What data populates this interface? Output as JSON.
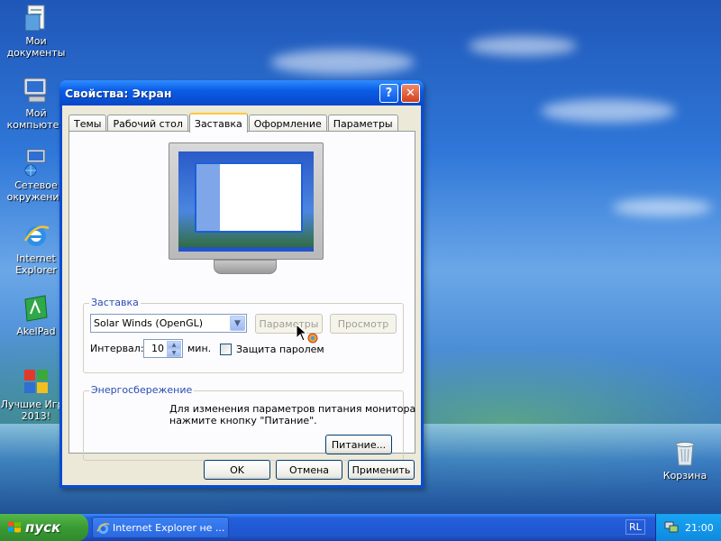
{
  "desktop": {
    "icons": [
      {
        "label": "Мои документы",
        "icon": "folder-icon"
      },
      {
        "label": "Мой компьютер",
        "icon": "computer-icon"
      },
      {
        "label": "Сетевое окружение",
        "icon": "network-icon"
      },
      {
        "label": "Internet Explorer",
        "icon": "ie-icon"
      },
      {
        "label": "AkelPad",
        "icon": "notepad-icon"
      },
      {
        "label": "Лучшие Игры 2013!",
        "icon": "games-icon"
      },
      {
        "label": "Корзина",
        "icon": "recycle-bin-icon"
      }
    ]
  },
  "window": {
    "title": "Свойства: Экран",
    "tabs": [
      {
        "label": "Темы"
      },
      {
        "label": "Рабочий стол"
      },
      {
        "label": "Заставка",
        "active": true
      },
      {
        "label": "Оформление"
      },
      {
        "label": "Параметры"
      }
    ],
    "screensaver": {
      "group_title": "Заставка",
      "selected": "Solar Winds (OpenGL)",
      "settings_button": "Параметры",
      "preview_button": "Просмотр",
      "interval_label": "Интервал:",
      "interval_value": "10",
      "interval_unit": "мин.",
      "password_label": "Защита паролем",
      "password_checked": false
    },
    "power": {
      "group_title": "Энергосбережение",
      "text_line1": "Для изменения параметров питания монитора",
      "text_line2": "нажмите кнопку \"Питание\".",
      "power_button": "Питание..."
    },
    "buttons": {
      "ok": "OK",
      "cancel": "Отмена",
      "apply": "Применить"
    }
  },
  "taskbar": {
    "start_label": "пуск",
    "task_label": "Internet Explorer не ...",
    "language": "RL",
    "clock": "21:00"
  },
  "colors": {
    "accent": "#0a5de6",
    "group_title": "#2a4cb4",
    "start_green": "#3a9a34"
  }
}
